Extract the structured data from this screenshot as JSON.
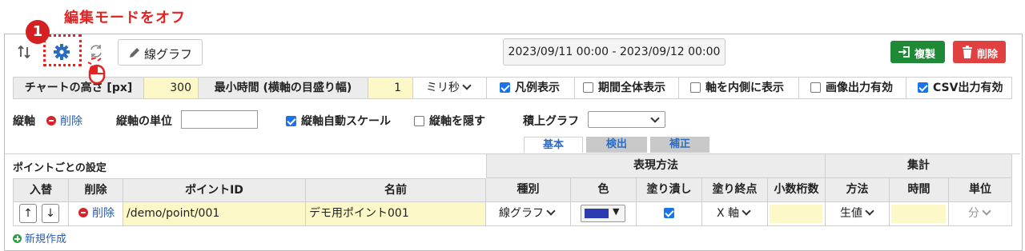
{
  "annotation": {
    "title": "編集モードをオフ",
    "step": "1"
  },
  "toolbar": {
    "graph_button": "線グラフ",
    "date_range": "2023/09/11 00:00 - 2023/09/12 00:00",
    "copy_button": "複製",
    "delete_button": "削除"
  },
  "settings": {
    "chart_height_label": "チャートの高さ [px]",
    "chart_height_value": "300",
    "min_time_label": "最小時間 (横軸の目盛り幅)",
    "min_time_value": "1",
    "min_time_unit": "ミリ秒",
    "legend": {
      "label": "凡例表示",
      "checked": true
    },
    "period_all": {
      "label": "期間全体表示",
      "checked": false
    },
    "axis_inside": {
      "label": "軸を内側に表示",
      "checked": false
    },
    "image_output": {
      "label": "画像出力有効",
      "checked": false
    },
    "csv_output": {
      "label": "CSV出力有効",
      "checked": true
    }
  },
  "axis": {
    "label": "縦軸",
    "delete_link": "削除",
    "unit_label": "縦軸の単位",
    "unit_value": "",
    "autoscale": {
      "label": "縦軸自動スケール",
      "checked": true
    },
    "hide": {
      "label": "縦軸を隠す",
      "checked": false
    },
    "stack_label": "積上グラフ",
    "stack_value": ""
  },
  "tabs": [
    "基本",
    "検出",
    "補正"
  ],
  "points": {
    "section_title": "ポイントごとの設定",
    "group_expression": "表現方法",
    "group_aggregate": "集計",
    "headers": [
      "入替",
      "削除",
      "ポイントID",
      "名前",
      "種別",
      "色",
      "塗り潰し",
      "塗り終点",
      "小数桁数",
      "方法",
      "時間",
      "単位"
    ],
    "rows": [
      {
        "up": "↑",
        "down": "↓",
        "delete": "削除",
        "point_id": "/demo/point/001",
        "name": "デモ用ポイント001",
        "type": "線グラフ",
        "color": "#2a3cb0",
        "fill": true,
        "fill_end": "X 軸",
        "decimals": "",
        "method": "生値",
        "time": "",
        "unit": "分"
      }
    ],
    "new_link": "新規作成"
  }
}
